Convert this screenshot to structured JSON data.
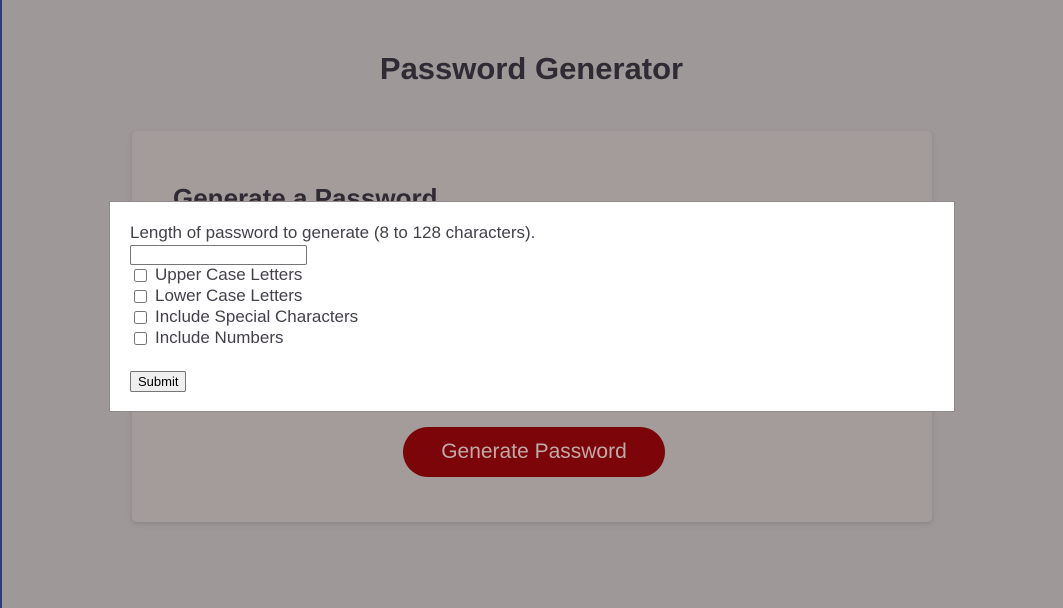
{
  "page": {
    "title": "Password Generator"
  },
  "card": {
    "heading": "Generate a Password",
    "generate_button_label": "Generate Password"
  },
  "modal": {
    "prompt": "Length of password to generate (8 to 128 characters).",
    "length_value": "",
    "options": [
      {
        "label": "Upper Case Letters",
        "checked": false
      },
      {
        "label": "Lower Case Letters",
        "checked": false
      },
      {
        "label": "Include Special Characters",
        "checked": false
      },
      {
        "label": "Include Numbers",
        "checked": false
      }
    ],
    "submit_label": "Submit"
  },
  "colors": {
    "background": "#9e9898",
    "card": "#a49b9b",
    "button": "#7b0508",
    "button_text": "#bfa9a9",
    "modal": "#ffffff"
  }
}
